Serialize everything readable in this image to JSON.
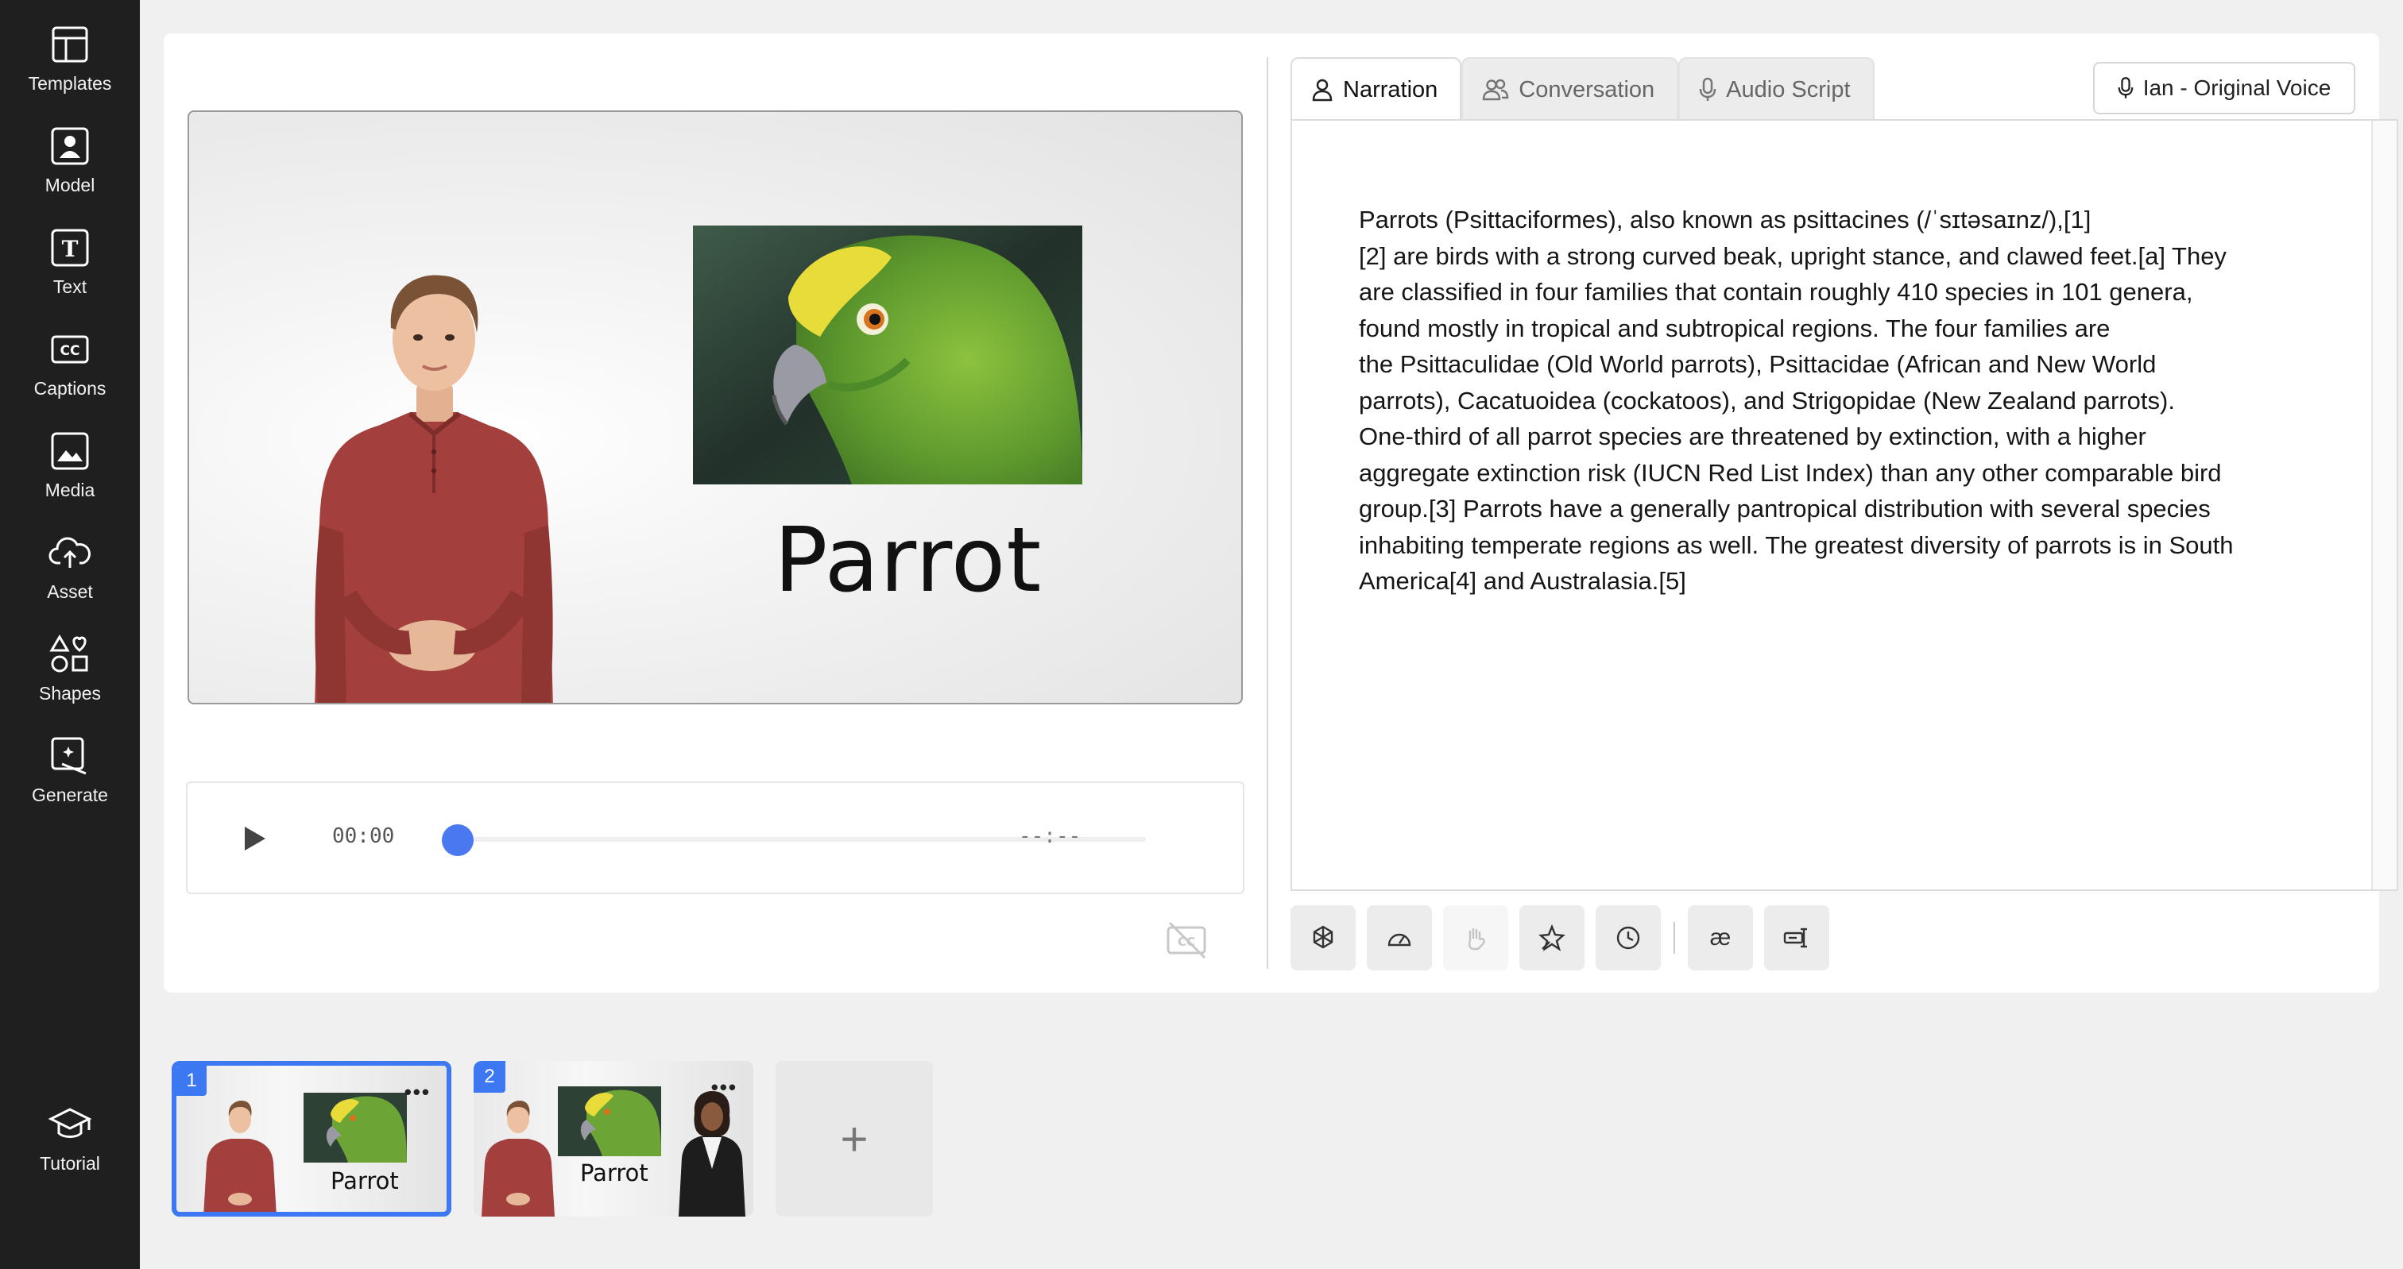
{
  "sidebar": {
    "items": [
      {
        "label": "Templates",
        "icon": "layout-icon"
      },
      {
        "label": "Model",
        "icon": "person-icon"
      },
      {
        "label": "Text",
        "icon": "text-icon"
      },
      {
        "label": "Captions",
        "icon": "captions-icon"
      },
      {
        "label": "Media",
        "icon": "image-icon"
      },
      {
        "label": "Asset",
        "icon": "upload-cloud-icon"
      },
      {
        "label": "Shapes",
        "icon": "shapes-icon"
      },
      {
        "label": "Generate",
        "icon": "generate-icon"
      }
    ],
    "tutorial": {
      "label": "Tutorial",
      "icon": "graduation-cap-icon"
    }
  },
  "preview": {
    "title": "Parrot"
  },
  "player": {
    "current_time": "00:00",
    "end_time": "--:--",
    "progress": 0
  },
  "tabs": [
    {
      "label": "Narration",
      "active": true
    },
    {
      "label": "Conversation",
      "active": false
    },
    {
      "label": "Audio Script",
      "active": false
    }
  ],
  "voice": {
    "label": "Ian - Original Voice"
  },
  "script": {
    "text": "Parrots (Psittaciformes), also known as psittacines (/ˈsɪtəsaɪnz/),[1]\n[2] are birds with a strong curved beak, upright stance, and clawed feet.[a] They\nare classified in four families that contain roughly 410 species in 101 genera,\nfound mostly in tropical and subtropical regions. The four families are\nthe Psittaculidae (Old World parrots), Psittacidae (African and New World\nparrots), Cacatuoidea (cockatoos), and Strigopidae (New Zealand parrots).\nOne-third of all parrot species are threatened by extinction, with a higher\naggregate extinction risk (IUCN Red List Index) than any other comparable bird\ngroup.[3] Parrots have a generally pantropical distribution with several species\ninhabiting temperate regions as well. The greatest diversity of parrots is in South\nAmerica[4] and Australasia.[5]"
  },
  "toolbar": {
    "tools": [
      "ai-icon",
      "speed-icon",
      "gesture-icon",
      "emphasis-icon",
      "pause-icon",
      "pronunciation-icon",
      "alias-icon"
    ],
    "pronunciation_glyph": "æ"
  },
  "slides": [
    {
      "number": "1",
      "label": "Parrot",
      "selected": true
    },
    {
      "number": "2",
      "label": "Parrot",
      "selected": false
    }
  ],
  "add_slide": {
    "glyph": "+"
  },
  "colors": {
    "accent": "#3b78f2",
    "sidebar": "#1f1f1f",
    "shirt": "#a3403d",
    "parrot_green": "#5f9a2e"
  }
}
